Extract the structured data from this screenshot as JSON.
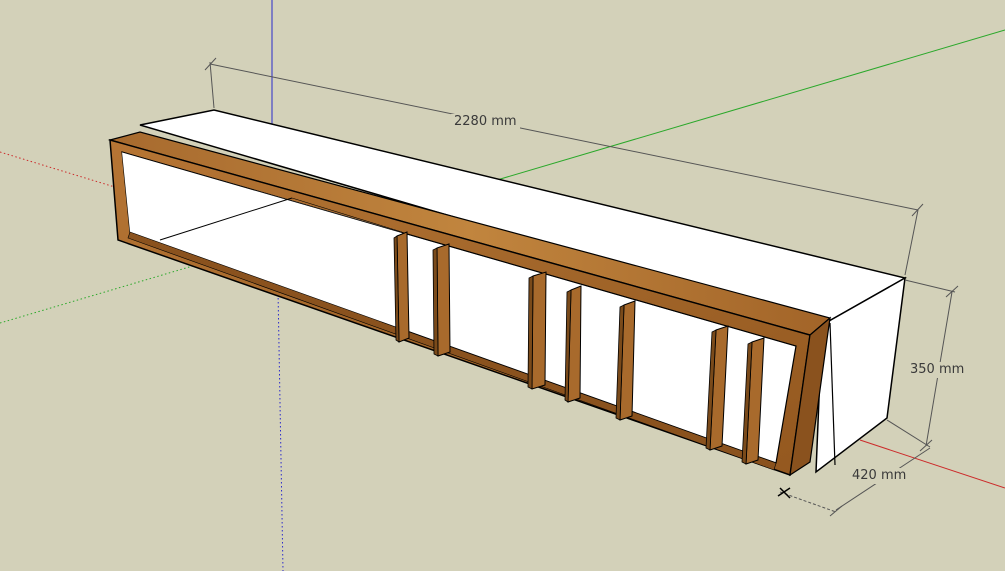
{
  "app": "3D modeling viewport",
  "dimensions": {
    "length": "2280 mm",
    "height": "350 mm",
    "depth": "420 mm"
  },
  "colors": {
    "background": "#d3d1b9",
    "axis_red": "#cc2a2a",
    "axis_green": "#2aa82a",
    "axis_blue": "#2a2acc",
    "wood": "#a86a2c",
    "wood_dark": "#7a4a1a",
    "panel_white": "#ffffff",
    "dimension_line": "#555555"
  },
  "model": {
    "name": "TV console cabinet",
    "compartments": 4,
    "door_slats": 7
  }
}
